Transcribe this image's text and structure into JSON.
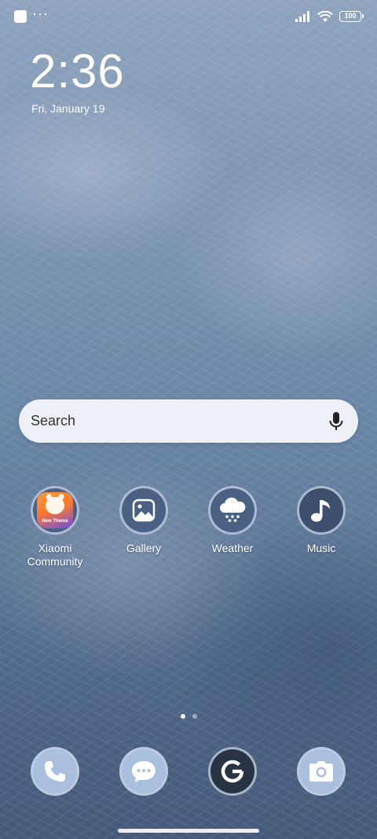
{
  "status_bar": {
    "notification_dots": "···",
    "battery_level": "100",
    "icons": [
      "notification-square-icon",
      "cellular-signal-icon",
      "wifi-icon",
      "battery-icon"
    ]
  },
  "clock": {
    "time": "2:36",
    "date": "Fri, January 19"
  },
  "search": {
    "placeholder": "Search",
    "icon": "microphone-icon"
  },
  "apps": [
    {
      "label": "Xiaomi Community",
      "icon": "xiaomi-community-icon"
    },
    {
      "label": "Gallery",
      "icon": "gallery-icon"
    },
    {
      "label": "Weather",
      "icon": "weather-icon"
    },
    {
      "label": "Music",
      "icon": "music-icon"
    }
  ],
  "app_badges": {
    "xiaomi_community_tile_text": "New Theme"
  },
  "page_indicator": {
    "pages": 2,
    "current": 1
  },
  "dock": [
    {
      "name": "Phone",
      "icon": "phone-icon"
    },
    {
      "name": "Messages",
      "icon": "messages-icon"
    },
    {
      "name": "Google",
      "icon": "google-icon"
    },
    {
      "name": "Camera",
      "icon": "camera-icon"
    }
  ],
  "colors": {
    "wallpaper_top": "#8ea3bd",
    "wallpaper_bottom": "#45597a",
    "search_bg": "#f4f6fa",
    "icon_slate": "#4a6184"
  }
}
